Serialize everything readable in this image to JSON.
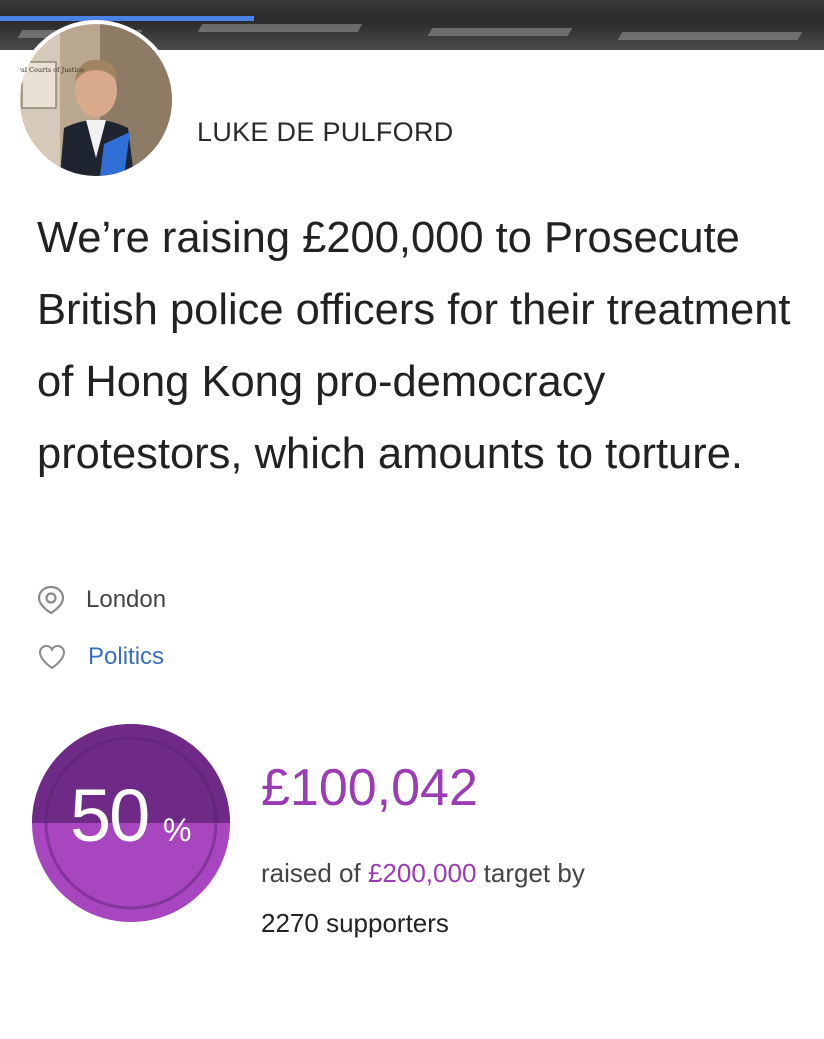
{
  "campaign": {
    "owner_name": "LUKE DE PULFORD",
    "avatar_sign_text": "The Royal Courts of Justice",
    "headline": "We’re raising £200,000 to Prosecute British police officers for their treatment of Hong Kong pro-democracy protestors, which amounts to torture.",
    "location": {
      "icon": "location-pin-icon",
      "label": "London"
    },
    "category": {
      "icon": "heart-icon",
      "label": "Politics",
      "color": "#3a6fbf"
    }
  },
  "progress": {
    "percent_value": "50",
    "percent_sign": "%",
    "fraction": 0.5,
    "raised_amount": "£100,042",
    "raised_prefix": "raised of",
    "target_amount": "£200,000",
    "target_suffix": "target by",
    "supporters_count": "2270",
    "supporters_label": "supporters",
    "accent_color": "#9b3cb4",
    "gauge_dark_color": "#6e2a86",
    "gauge_light_color": "#a746bf"
  },
  "banner": {
    "load_progress_color": "#4a82e6"
  }
}
